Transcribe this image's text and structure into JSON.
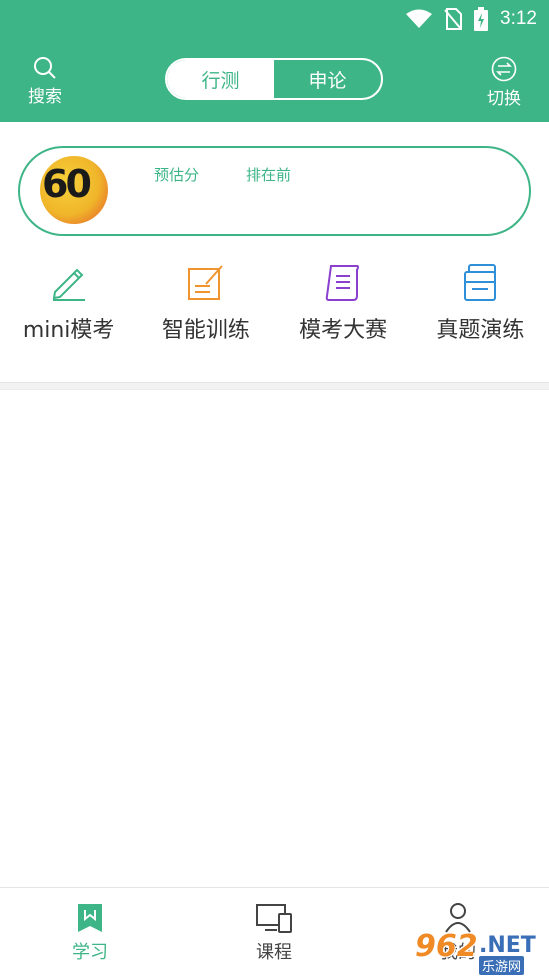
{
  "status_bar": {
    "time": "3:12"
  },
  "header": {
    "search_label": "搜索",
    "switch_label": "切换",
    "tabs": [
      {
        "label": "行测",
        "active": false
      },
      {
        "label": "申论",
        "active": true
      }
    ]
  },
  "score_card": {
    "avatar_text": "60",
    "estimated_score_label": "预估分",
    "rank_label": "排在前"
  },
  "features": [
    {
      "label": "mini模考",
      "icon": "pencil-icon",
      "color": "#3db587"
    },
    {
      "label": "智能训练",
      "icon": "edit-note-icon",
      "color": "#f0952d"
    },
    {
      "label": "模考大赛",
      "icon": "scroll-icon",
      "color": "#8a3fcf"
    },
    {
      "label": "真题演练",
      "icon": "document-stack-icon",
      "color": "#2f8fd8"
    }
  ],
  "bottom_nav": [
    {
      "label": "学习",
      "icon": "book-icon",
      "active": true
    },
    {
      "label": "课程",
      "icon": "devices-icon",
      "active": false
    },
    {
      "label": "我的",
      "icon": "user-icon",
      "active": false
    }
  ],
  "watermark": {
    "number": "962",
    "suffix": ".NET",
    "sub": "乐游网"
  },
  "colors": {
    "brand": "#3db587",
    "text": "#333333"
  }
}
